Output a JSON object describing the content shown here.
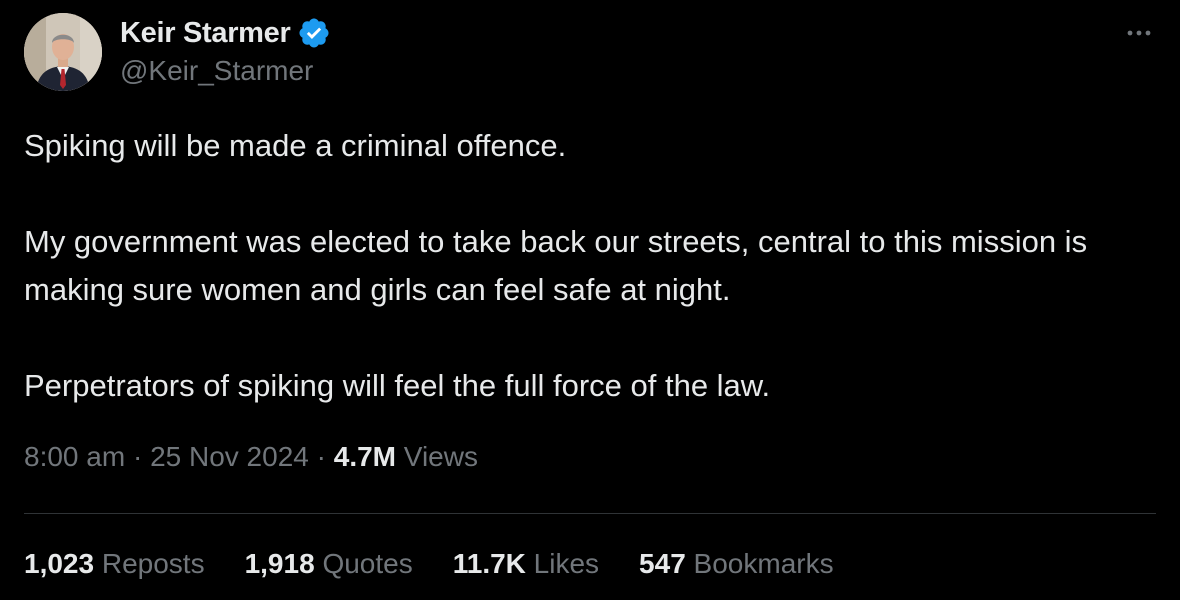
{
  "author": {
    "display_name": "Keir Starmer",
    "handle": "@Keir_Starmer",
    "verified_icon": "verified-badge-icon",
    "verified_color": "#1d9bf0"
  },
  "menu_icon": "more-horizontal-icon",
  "tweet": {
    "paragraphs": [
      "Spiking will be made a criminal offence.",
      "My government was elected to take back our streets, central to this mission is making sure women and girls can feel safe at night.",
      "Perpetrators of spiking will feel the full force of the law."
    ]
  },
  "meta": {
    "time": "8:00 am",
    "separator": "·",
    "date": "25 Nov 2024",
    "views_count": "4.7M",
    "views_label": "Views"
  },
  "stats": {
    "reposts": {
      "count": "1,023",
      "label": "Reposts"
    },
    "quotes": {
      "count": "1,918",
      "label": "Quotes"
    },
    "likes": {
      "count": "11.7K",
      "label": "Likes"
    },
    "bookmarks": {
      "count": "547",
      "label": "Bookmarks"
    }
  },
  "colors": {
    "background": "#000000",
    "primary_text": "#e7e9ea",
    "secondary_text": "#71767b",
    "divider": "#2f3336"
  }
}
